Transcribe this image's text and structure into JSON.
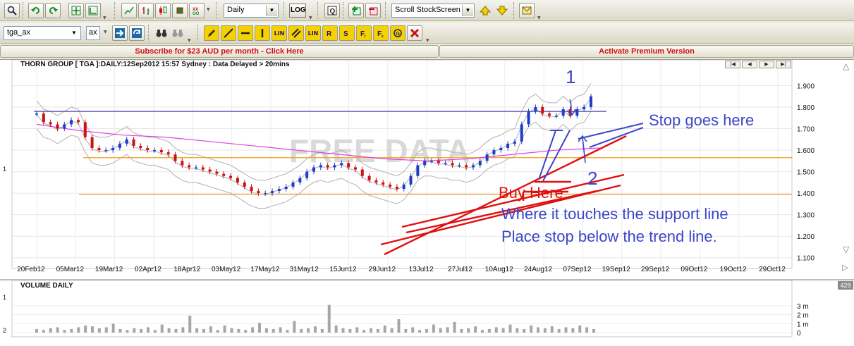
{
  "toolbar1": {
    "period_select": "Daily",
    "log_label": "LOG",
    "scan_select": "Scroll StockScreen"
  },
  "toolbar2": {
    "symbol_input": "tga_ax",
    "exchange_input": "ax",
    "line_tool_labels": [
      "LIN",
      "LIN"
    ]
  },
  "banner": {
    "subscribe": "Subscribe for $23 AUD per month - Click Here",
    "premium": "Activate Premium Version"
  },
  "chart": {
    "header": "THORN GROUP [ TGA ]:DAILY:12Sep2012 15:57 Sydney : Data Delayed > 20mins",
    "watermark": "FREE DATA",
    "side_label": "1",
    "colors": {
      "price_up": "#1e3cc8",
      "price_down": "#cc1111",
      "trend": "#e01010",
      "ma_long": "#e040e0",
      "support": "#f0a020",
      "resistance": "#2a2aa0",
      "annotation": "#3a46c8",
      "bollinger": "#b0b0b0"
    }
  },
  "annotations": {
    "marker_1": "1",
    "marker_2": "2",
    "stop": "Stop goes here",
    "buy": "Buy Here",
    "note_line1": "Where it touches the support line",
    "note_line2": "Place stop below the trend line."
  },
  "volume": {
    "title": "VOLUME DAILY",
    "badge": "428",
    "side_top": "1",
    "side_bottom": "2"
  },
  "chart_data": {
    "type": "line",
    "title": "THORN GROUP [ TGA ]:DAILY:12Sep2012 15:57 Sydney : Data Delayed > 20mins",
    "x_tick_labels": [
      "20Feb12",
      "05Mar12",
      "19Mar12",
      "02Apr12",
      "18Apr12",
      "03May12",
      "17May12",
      "31May12",
      "15Jun12",
      "29Jun12",
      "13Jul12",
      "27Jul12",
      "10Aug12",
      "24Aug12",
      "07Sep12",
      "19Sep12",
      "29Sep12",
      "09Oct12",
      "19Oct12",
      "29Oct12"
    ],
    "y_tick_labels": [
      "1.900",
      "1.800",
      "1.700",
      "1.600",
      "1.500",
      "1.400",
      "1.300",
      "1.200",
      "1.100"
    ],
    "ylim": [
      1.05,
      1.98
    ],
    "price_series": [
      1.77,
      1.73,
      1.72,
      1.7,
      1.72,
      1.74,
      1.73,
      1.66,
      1.61,
      1.6,
      1.6,
      1.61,
      1.63,
      1.65,
      1.62,
      1.61,
      1.6,
      1.6,
      1.59,
      1.58,
      1.55,
      1.53,
      1.52,
      1.52,
      1.51,
      1.5,
      1.49,
      1.48,
      1.47,
      1.45,
      1.43,
      1.41,
      1.4,
      1.4,
      1.41,
      1.42,
      1.43,
      1.45,
      1.47,
      1.5,
      1.52,
      1.53,
      1.52,
      1.53,
      1.54,
      1.52,
      1.51,
      1.48,
      1.46,
      1.45,
      1.44,
      1.43,
      1.42,
      1.44,
      1.48,
      1.53,
      1.55,
      1.55,
      1.54,
      1.54,
      1.53,
      1.53,
      1.52,
      1.53,
      1.55,
      1.58,
      1.6,
      1.61,
      1.63,
      1.64,
      1.72,
      1.78,
      1.8,
      1.77,
      1.76,
      1.76,
      1.79,
      1.76,
      1.79,
      1.8,
      1.85
    ],
    "long_ma": [
      1.72,
      1.69,
      1.67,
      1.66,
      1.64,
      1.62,
      1.6,
      1.58,
      1.56,
      1.55,
      1.56,
      1.58,
      1.6,
      1.61
    ],
    "support_levels": [
      1.395,
      1.565
    ],
    "resistance_level": 1.78,
    "volume_axis_labels": [
      "3 m",
      "2 m",
      "1 m",
      "0"
    ],
    "volume_series_m": [
      0.4,
      0.3,
      0.5,
      0.6,
      0.3,
      0.4,
      0.6,
      0.8,
      0.7,
      0.5,
      0.6,
      1.0,
      0.4,
      0.3,
      0.5,
      0.4,
      0.6,
      0.3,
      0.9,
      0.5,
      0.4,
      0.6,
      1.9,
      0.5,
      0.4,
      0.7,
      0.3,
      0.8,
      0.5,
      0.4,
      0.3,
      0.6,
      1.1,
      0.5,
      0.4,
      0.6,
      0.3,
      1.3,
      0.4,
      0.5,
      0.7,
      0.4,
      3.1,
      0.8,
      0.5,
      0.4,
      0.6,
      0.3,
      0.5,
      0.4,
      0.8,
      0.5,
      1.5,
      0.4,
      0.6,
      0.3,
      0.4,
      0.9,
      0.5,
      0.6,
      1.2,
      0.4,
      0.5,
      0.7,
      0.3,
      0.4,
      0.6,
      0.5,
      0.9,
      0.5,
      0.4,
      0.8,
      0.6,
      0.5,
      0.7,
      0.4,
      0.6,
      0.5,
      0.8,
      0.6,
      0.4
    ]
  }
}
